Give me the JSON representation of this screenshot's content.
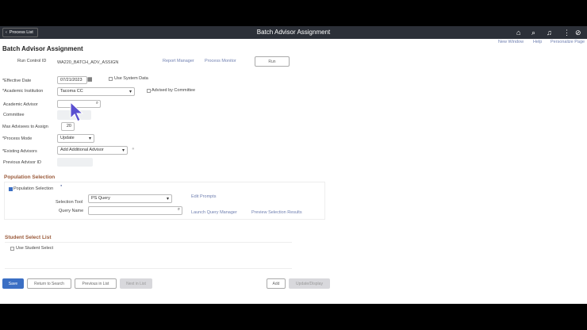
{
  "header": {
    "back_label": "Process List",
    "title": "Batch Advisor Assignment",
    "icons": [
      "home-icon",
      "search-icon",
      "bell-icon",
      "more-icon",
      "compass-icon"
    ]
  },
  "toplinks": {
    "new_window": "New Window",
    "help": "Help",
    "personalize": "Personalize Page"
  },
  "page_title": "Batch Advisor Assignment",
  "run": {
    "label": "Run Control ID",
    "value": "WA220_BATCH_ADV_ASSIGN",
    "report_manager": "Report Manager",
    "process_monitor": "Process Monitor",
    "run_button": "Run"
  },
  "form": {
    "effective_date": {
      "label": "*Effective Date",
      "value": "07/21/2023"
    },
    "use_system_date": {
      "label": "Use System Data",
      "checked": false
    },
    "institution": {
      "label": "*Academic Institution",
      "value": "Tacoma CC"
    },
    "advised_by_committee": {
      "label": "Advised by Committee",
      "checked": false
    },
    "advisor": {
      "label": "Academic Advisor",
      "value": ""
    },
    "committee": {
      "label": "Committee"
    },
    "max_advisees": {
      "label": "Max Advisees to Assign",
      "value": "20"
    },
    "process_mode": {
      "label": "*Process Mode",
      "value": "Update"
    },
    "existing_advisors": {
      "label": "*Existing Advisors",
      "value": "Add Additional Advisor"
    },
    "previous_advisor": {
      "label": "Previous Advisor ID"
    }
  },
  "population": {
    "title": "Population Selection",
    "checkbox_label": "Population Selection",
    "checked": true,
    "tool_label": "Selection Tool",
    "tool_value": "PS Query",
    "query_label": "Query Name",
    "query_value": "",
    "edit_prompts": "Edit Prompts",
    "launch_query": "Launch Query Manager",
    "preview": "Preview Selection Results"
  },
  "student_select": {
    "title": "Student Select List",
    "checkbox_label": "Use Student Select",
    "checked": false
  },
  "buttons": {
    "save": "Save",
    "return": "Return to Search",
    "previous": "Previous in List",
    "next": "Next in List",
    "add": "Add",
    "update": "Update/Display"
  },
  "colors": {
    "header_bg": "#2c3038",
    "primary": "#3b6fc4",
    "section": "#9a5a3a",
    "link": "#6f7fb0"
  }
}
